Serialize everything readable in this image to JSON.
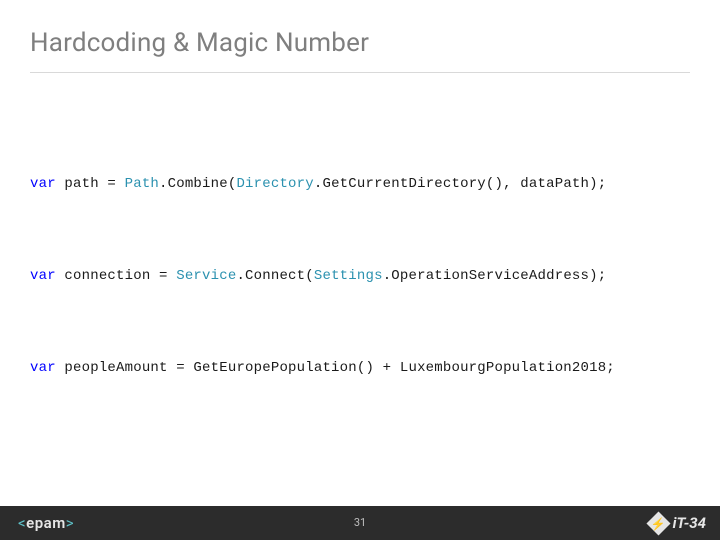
{
  "title": "Hardcoding & Magic Number",
  "code": {
    "line1": {
      "t1": "var",
      "t2": " path = ",
      "t3": "Path",
      "t4": ".Combine(",
      "t5": "Directory",
      "t6": ".GetCurrentDirectory(), dataPath);"
    },
    "line2": {
      "t1": "var",
      "t2": " connection = ",
      "t3": "Service",
      "t4": ".Connect(",
      "t5": "Settings",
      "t6": ".OperationServiceAddress);"
    },
    "line3": {
      "t1": "var",
      "t2": " peopleAmount = GetEuropePopulation() + LuxembourgPopulation2018;"
    }
  },
  "footer": {
    "brand_open": "<",
    "brand_name": "epam",
    "brand_close": ">",
    "page_number": "31",
    "right_label": "iT-34",
    "bolt_glyph": "⚡"
  }
}
